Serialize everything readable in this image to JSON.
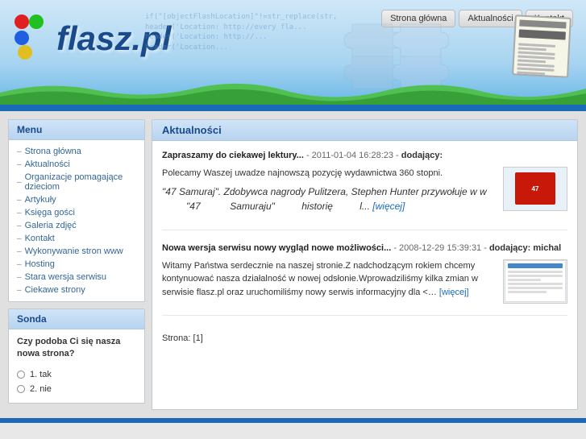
{
  "header": {
    "nav": {
      "home_label": "Strona główna",
      "news_label": "Aktualności",
      "contact_label": "Kontakt"
    },
    "logo_text": "flasz.pl",
    "code_snippet": "if(\"[objectFlashLocation]\"!=str_replace(str, header('Location: http://every fla'))"
  },
  "sidebar": {
    "menu_title": "Menu",
    "menu_items": [
      {
        "label": "Strona główna"
      },
      {
        "label": "Aktualności"
      },
      {
        "label": "Organizacje pomagające dzieciom"
      },
      {
        "label": "Artykuły"
      },
      {
        "label": "Księga gości"
      },
      {
        "label": "Galeria zdjęć"
      },
      {
        "label": "Kontakt"
      },
      {
        "label": "Wykonywanie stron www"
      },
      {
        "label": "Hosting"
      },
      {
        "label": "Stara wersja serwisu"
      },
      {
        "label": "Ciekawe strony"
      }
    ],
    "poll_title": "Sonda",
    "poll_question": "Czy podoba Ci się nasza nowa strona?",
    "poll_options": [
      {
        "label": "1. tak"
      },
      {
        "label": "2. nie"
      }
    ]
  },
  "content": {
    "title": "Aktualności",
    "news": [
      {
        "id": "news1",
        "header_title": "Zapraszamy do ciekawej lektury...",
        "meta": "- 2011-01-04 16:28:23 -",
        "dodajacy_label": "dodający:",
        "dodajacy": "",
        "body_text": "Polecamy Waszej uwadze najnowszą pozycję wydawnictwa 360 stopni.",
        "quote": "\"47 Samuraj\". Zdobywca nagrody Pulitzera, Stephen Hunter przywołuje w w \"47 Samuraju\" historię l...",
        "wiecej": "[więcej]",
        "has_thumb": true,
        "thumb_type": "book"
      },
      {
        "id": "news2",
        "header_title": "Nowa wersja serwisu nowy wygląd nowe możliwości...",
        "meta": "- 2008-12-29 15:39:31 -",
        "dodajacy_label": "dodający:",
        "dodajacy": "michal",
        "body_text": "Witamy Państwa serdecznie na naszej stronie.Z nadchodzącym rokiem chcemy kontynuować nasza działalność w nowej odsłonie.Wprowadziliśmy kilka zmian w serwisie flasz.pl oraz uruchomiliśmy nowy serwis informacyjny dla",
        "ellipsis": "<…",
        "wiecej": "[więcej]",
        "has_thumb": true,
        "thumb_type": "site"
      }
    ],
    "pagination_label": "Strona:",
    "pagination_current": "[1]"
  }
}
